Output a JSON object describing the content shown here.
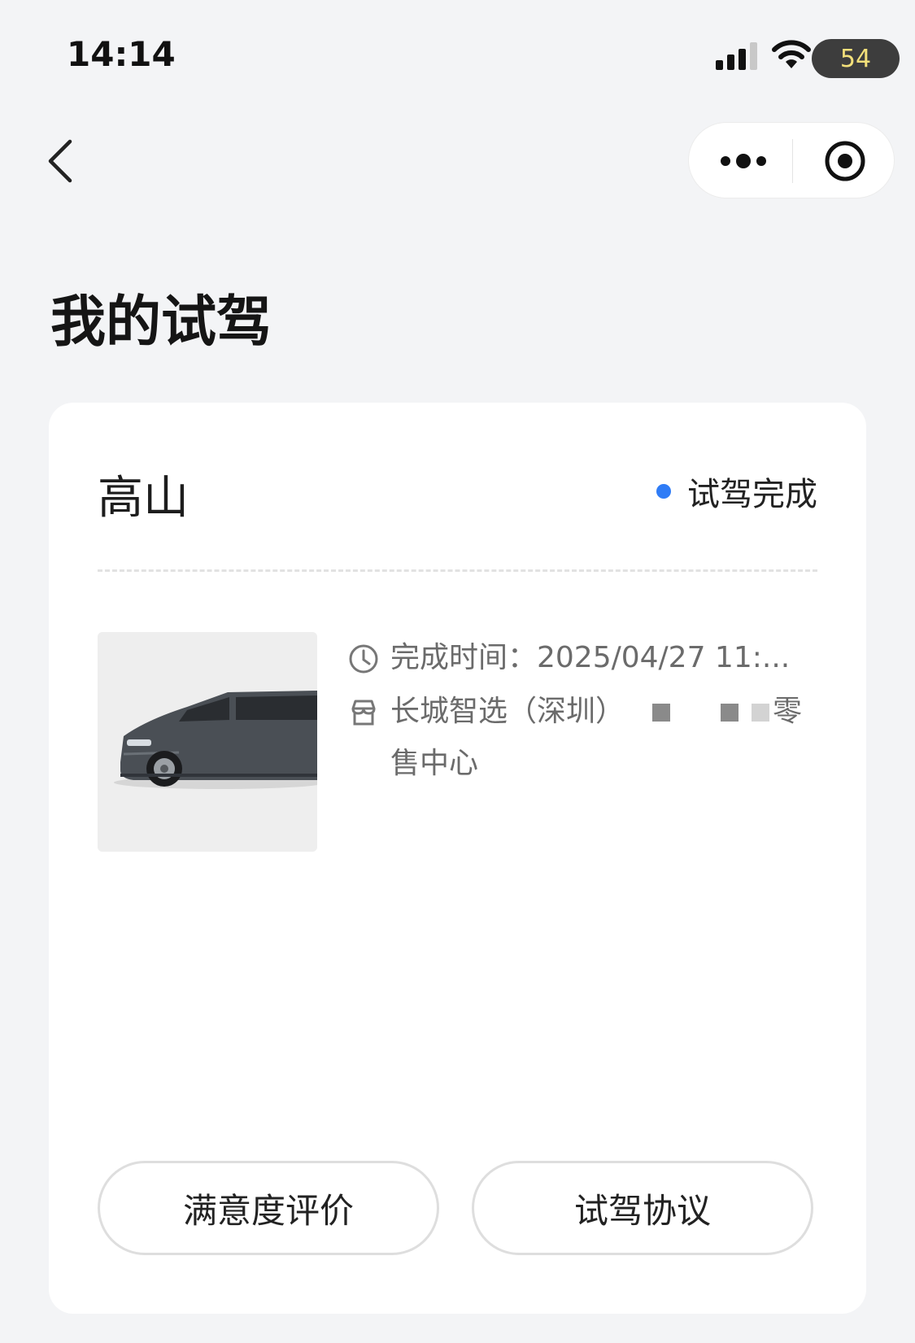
{
  "status_bar": {
    "time": "14:14",
    "battery": "54",
    "icons": [
      "signal-icon",
      "wifi-icon"
    ]
  },
  "nav": {
    "back_icon": "chevron-left-icon",
    "more_icon": "more-dots-icon",
    "close_icon": "target-circle-icon"
  },
  "page": {
    "title": "我的试驾"
  },
  "card": {
    "car_name": "高山",
    "status_text": "试驾完成",
    "status_color": "#2f7cf6",
    "image_icon": "minivan-image",
    "completion_time": "完成时间：2025/04/27 11:...",
    "store_name_prefix": "长城智选（深圳）",
    "store_name_suffix": "零售中心",
    "buttons": {
      "rating": "满意度评价",
      "agreement": "试驾协议"
    }
  }
}
